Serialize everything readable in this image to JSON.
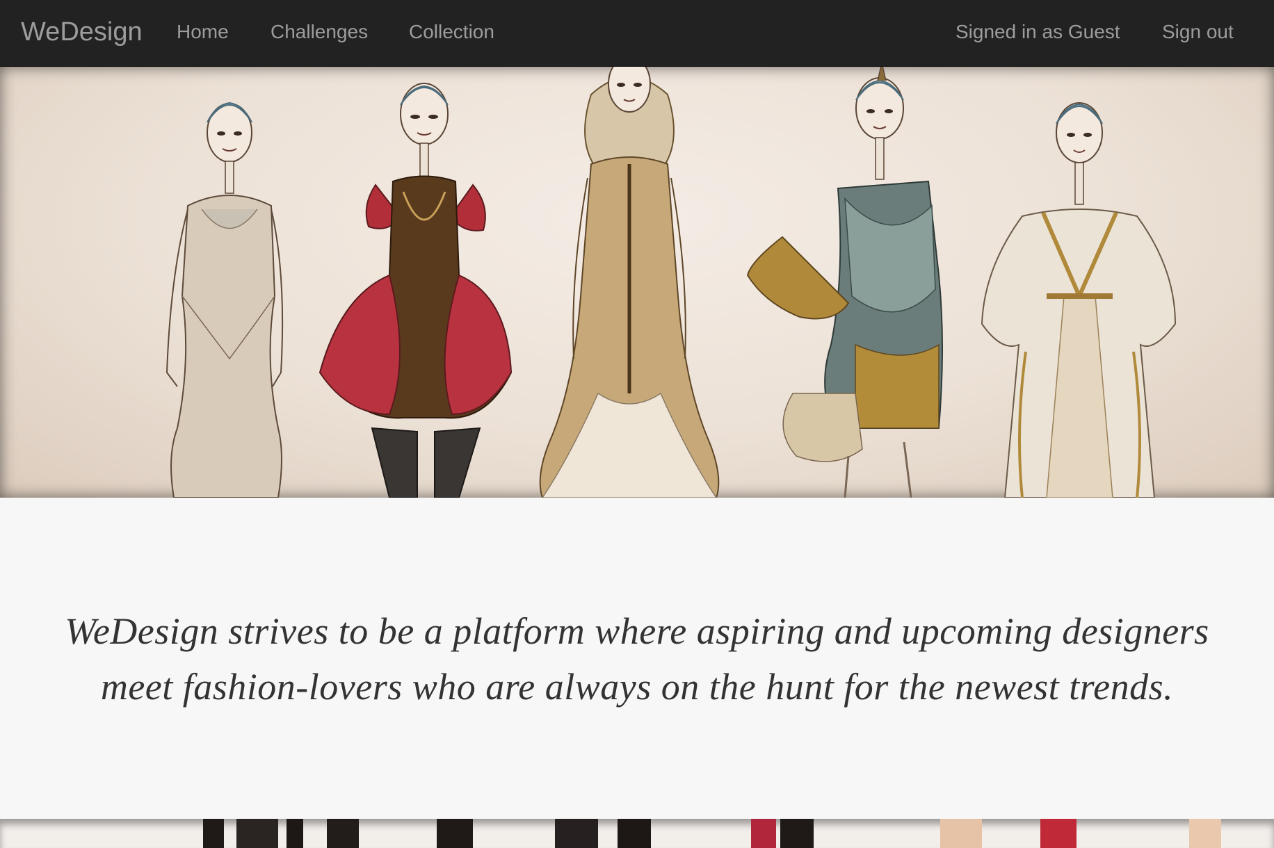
{
  "navbar": {
    "brand": "WeDesign",
    "links": [
      {
        "label": "Home"
      },
      {
        "label": "Challenges"
      },
      {
        "label": "Collection"
      }
    ],
    "user_status": "Signed in as Guest",
    "sign_out": "Sign out"
  },
  "hero": {
    "image_icon": "fashion-sketch-illustration",
    "figures": [
      "beige-gown",
      "red-puff-dress",
      "feathered-coat-gown",
      "draped-cocktail-dress",
      "kaftan-gown"
    ]
  },
  "tagline": {
    "line1": "WeDesign strives to be a platform where aspiring and upcoming designers",
    "line2": "meet fashion-lovers who are always on the hunt for the newest trends."
  },
  "strip": {
    "image_icon": "fashion-sketch-strip"
  },
  "colors": {
    "navbar_bg": "#222222",
    "nav_text": "#9d9d9d",
    "page_bg": "#f7f7f7",
    "tagline_text": "#333333"
  }
}
